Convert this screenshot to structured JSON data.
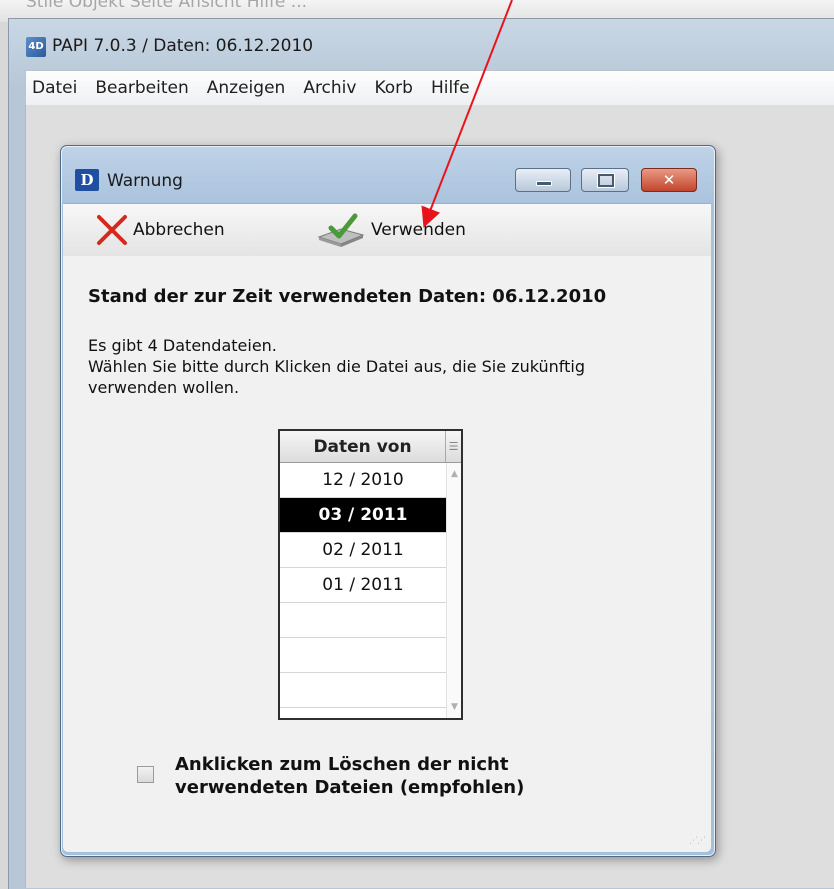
{
  "background_strip_text": "Stile  Objekt  Seite  Ansicht  Hilfe  ...",
  "app": {
    "title": "PAPI 7.0.3 / Daten: 06.12.2010",
    "icon": "papi-app-icon"
  },
  "menu": {
    "items": [
      {
        "label": "Datei"
      },
      {
        "label": "Bearbeiten"
      },
      {
        "label": "Anzeigen"
      },
      {
        "label": "Archiv"
      },
      {
        "label": "Korb"
      },
      {
        "label": "Hilfe"
      }
    ]
  },
  "dialog": {
    "title": "Warnung",
    "icon_text": "D",
    "toolbar": {
      "cancel_label": "Abbrechen",
      "use_label": "Verwenden"
    },
    "headline": "Stand der zur Zeit verwendeten Daten: 06.12.2010",
    "body_lines": [
      "Es gibt 4 Datendateien.",
      "Wählen Sie bitte durch Klicken die Datei aus, die Sie zukünftig",
      "verwenden wollen."
    ],
    "list": {
      "header": "Daten von",
      "rows": [
        "12 / 2010",
        "03 / 2011",
        "02 / 2011",
        "01 / 2011",
        "",
        "",
        ""
      ],
      "selected_index": 1
    },
    "checkbox": {
      "checked": false,
      "label_lines": [
        "Anklicken zum Löschen der nicht",
        "verwendeten Dateien (empfohlen)"
      ]
    },
    "close_glyph": "✕"
  },
  "colors": {
    "annotation_arrow": "#e8141c",
    "selected_row_bg": "#000000",
    "close_button": "#c4442c"
  }
}
